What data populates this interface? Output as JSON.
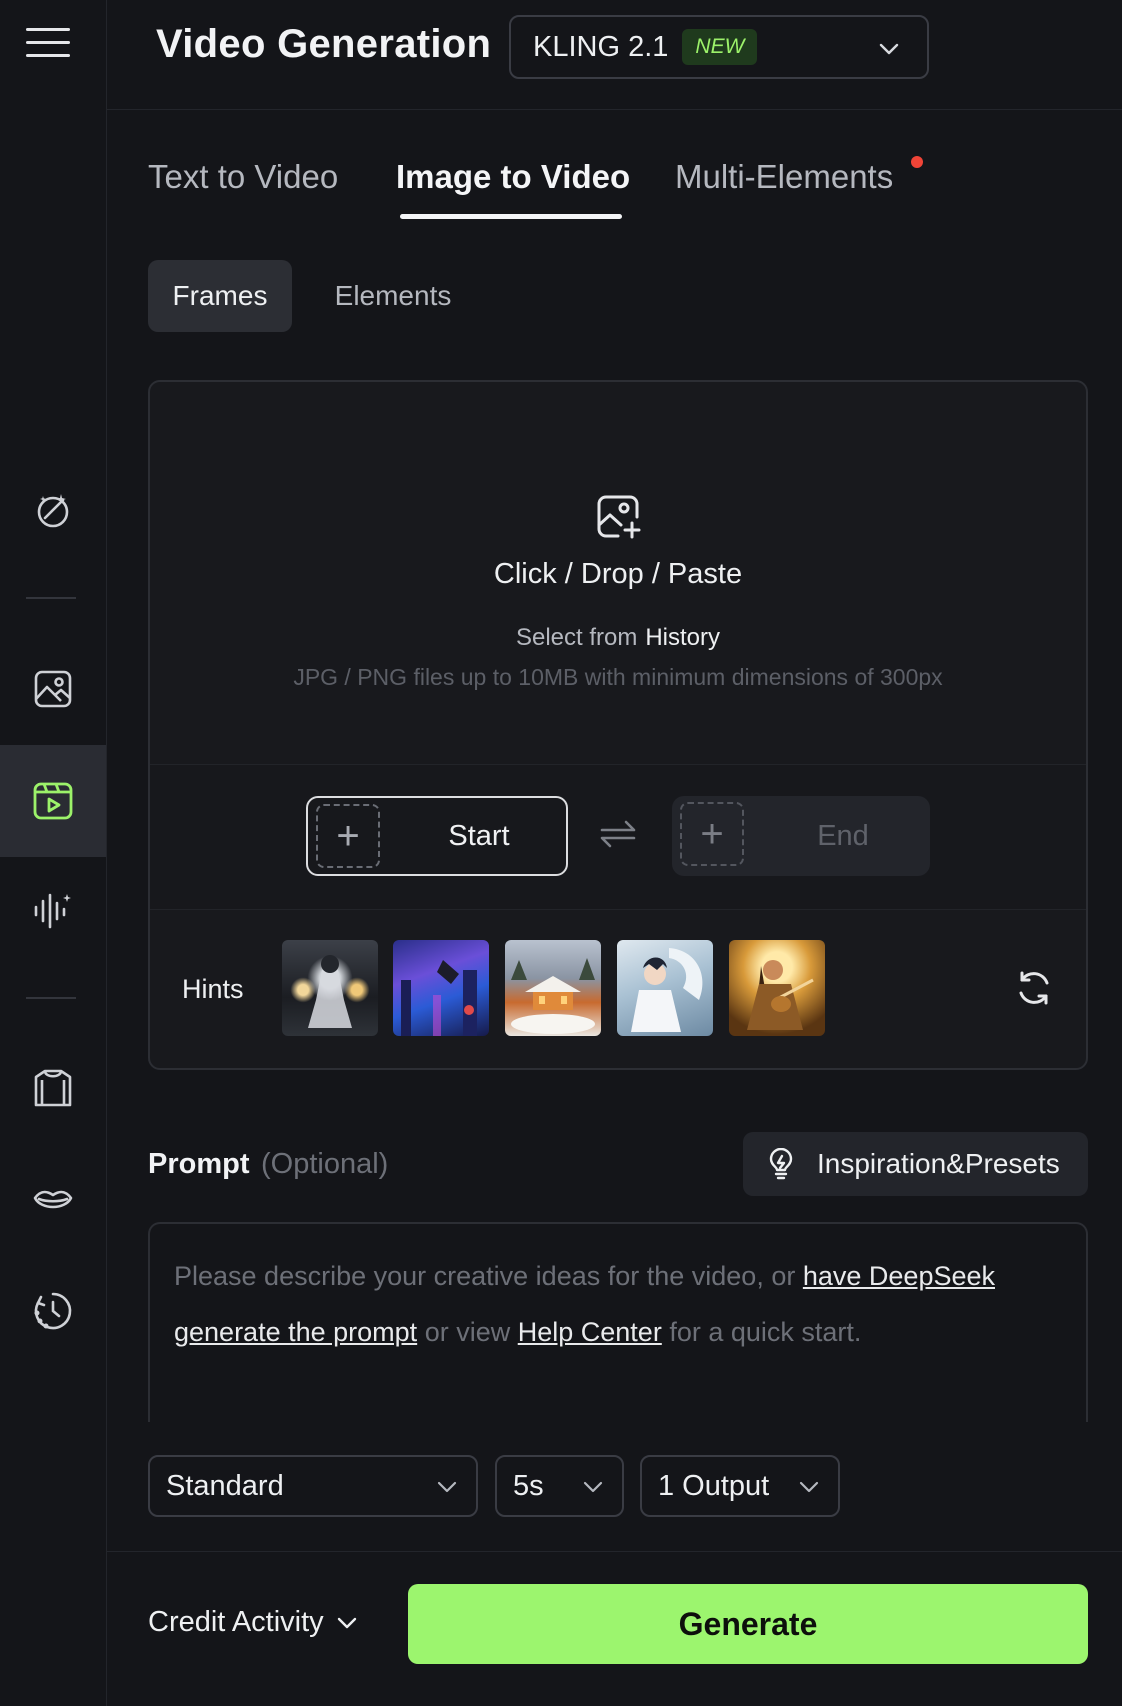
{
  "header": {
    "title": "Video Generation",
    "model": {
      "name": "KLING 2.1",
      "badge": "NEW"
    }
  },
  "tabs": [
    {
      "label": "Text to Video",
      "active": false
    },
    {
      "label": "Image to Video",
      "active": true
    },
    {
      "label": "Multi-Elements",
      "active": false,
      "has_notification_dot": true
    }
  ],
  "subtabs": [
    {
      "label": "Frames",
      "active": true
    },
    {
      "label": "Elements",
      "active": false
    }
  ],
  "upload": {
    "main_text": "Click / Drop / Paste",
    "history_prefix": "Select from",
    "history_link": "History",
    "note": "JPG / PNG files up to 10MB with minimum dimensions of 300px"
  },
  "frames": {
    "start_label": "Start",
    "end_label": "End"
  },
  "hints": {
    "label": "Hints",
    "thumbnails": [
      "hint-warrior",
      "hint-city-fall",
      "hint-snow-village",
      "hint-dragon-boy",
      "hint-lute-girl"
    ]
  },
  "prompt": {
    "title": "Prompt",
    "optional": "(Optional)",
    "presets_label": "Inspiration&Presets",
    "placeholder_part1": "Please describe your creative ideas for the video, or",
    "link_deepseek": "have DeepSeek generate the prompt",
    "placeholder_part2": "or view",
    "link_help": "Help Center",
    "placeholder_part3": "for a quick start."
  },
  "settings": {
    "mode": "Standard",
    "duration": "5s",
    "outputs": "1 Output"
  },
  "footer": {
    "credit_label": "Credit Activity",
    "generate_label": "Generate"
  },
  "colors": {
    "accent": "#9cf56e",
    "background": "#141519",
    "notification": "#f04437"
  },
  "sidebar_icons": [
    "menu-icon",
    "magic-wand-icon",
    "image-icon",
    "video-icon",
    "audio-wave-icon",
    "shirt-icon",
    "lips-icon",
    "history-icon"
  ]
}
